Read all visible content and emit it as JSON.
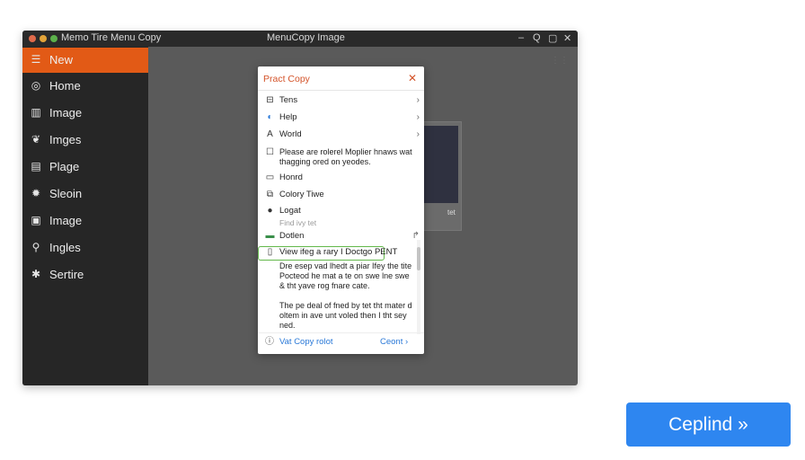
{
  "window": {
    "title_left": "Memo Tire  Menu Copy",
    "title_center": "MenuCopy Image",
    "controls": [
      "–",
      "Q",
      "▢",
      "✕"
    ]
  },
  "sidebar": {
    "items": [
      {
        "label": "New",
        "icon": "list-icon",
        "active": true
      },
      {
        "label": "Home",
        "icon": "home-icon",
        "active": false
      },
      {
        "label": "Image",
        "icon": "image-icon",
        "active": false
      },
      {
        "label": "Imges",
        "icon": "bird-icon",
        "active": false
      },
      {
        "label": "Plage",
        "icon": "page-icon",
        "active": false
      },
      {
        "label": "Sleoin",
        "icon": "gear-icon",
        "active": false
      },
      {
        "label": "Image",
        "icon": "picture-icon",
        "active": false
      },
      {
        "label": "Ingles",
        "icon": "key-icon",
        "active": false
      },
      {
        "label": "Sertire",
        "icon": "star-icon",
        "active": false
      }
    ]
  },
  "background": {
    "card_caption": "tet"
  },
  "dialog": {
    "title": "Pract Copy",
    "close": "✕",
    "items": [
      {
        "label": "Tens",
        "has_submenu": true
      },
      {
        "label": "Help",
        "has_submenu": true
      },
      {
        "label": "World",
        "has_submenu": true
      },
      {
        "label": "Please are rolerel Moplier hnaws wat thagging ored on yeodes."
      },
      {
        "label": "Honrd"
      },
      {
        "label": "Colory Tiwe"
      },
      {
        "label": "Logat",
        "sub": "Find ivy tet"
      },
      {
        "label": "Dotlen",
        "has_submenu": true
      },
      {
        "label": "View ifeg a rary I Doctgo PENT"
      }
    ],
    "paragraph1": "Dre esep vad lhedt a piar Ifey the tite Pocteod he mat a te on swe lne swe & tht yave rog fnare cate.",
    "paragraph2": "The pe deal of fned by tet tht mater d oltem in ave unt voled then I tht sey ned.",
    "footer_left": "Vat Copy rolot",
    "footer_right": "Ceont"
  },
  "cta": {
    "label": "Ceplind »"
  },
  "colors": {
    "accent": "#e25a16",
    "cta": "#2e86f0",
    "link": "#2a79d8",
    "focus": "#63b84b"
  }
}
